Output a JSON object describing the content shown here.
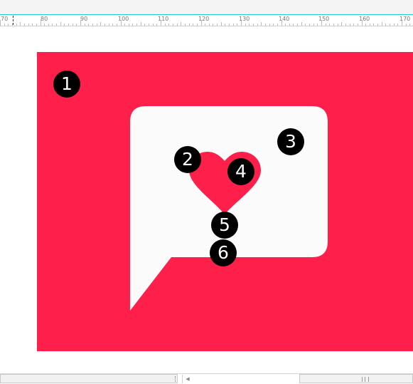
{
  "ruler": {
    "labels": [
      "70",
      "80",
      "90",
      "100",
      "110",
      "120",
      "130",
      "140",
      "150",
      "160",
      "170"
    ]
  },
  "canvas": {
    "background_color": "#ff1f4b",
    "bubble_color": "#fcfbfc",
    "heart_color": "#ff1f4b"
  },
  "callouts": [
    "1",
    "2",
    "3",
    "4",
    "5",
    "6"
  ],
  "icons": {
    "scroll_left": "left-arrow-icon"
  }
}
